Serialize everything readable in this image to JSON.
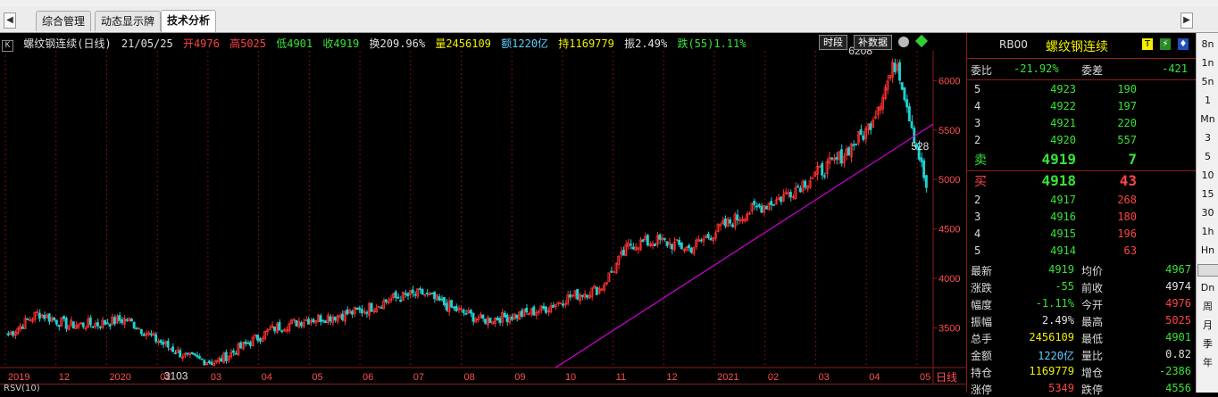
{
  "tabs": {
    "items": [
      "综合管理",
      "动态显示牌",
      "技术分析"
    ],
    "active": 2
  },
  "infobar": {
    "k_label": "K",
    "name": "螺纹钢连续(日线)",
    "date": "21/05/25",
    "open": "开4976",
    "high": "高5025",
    "low": "低4901",
    "close": "收4919",
    "turnover": "换209.96%",
    "volume": "量2456109",
    "amount": "额1220亿",
    "position": "持1169779",
    "amplitude": "振2.49%",
    "change": "跌(55)1.11%",
    "btn_period": "时段",
    "btn_fill": "补数据"
  },
  "chart_data": {
    "type": "candlestick",
    "title": "螺纹钢连续(日线)",
    "x_ticks": [
      "2019",
      "12",
      "2020",
      "02",
      "03",
      "04",
      "05",
      "06",
      "07",
      "08",
      "09",
      "10",
      "11",
      "12",
      "2021",
      "02",
      "03",
      "04",
      "05"
    ],
    "y_ticks": [
      3500,
      4000,
      4500,
      5000,
      5500,
      6000
    ],
    "ylim": [
      3100,
      6300
    ],
    "annotations": [
      {
        "text": "6208",
        "value": 6208
      },
      {
        "text": "3103",
        "value": 3103
      },
      {
        "text": "528",
        "value": 5280
      }
    ],
    "trendline_color": "#d400d4",
    "up_color": "#ff3030",
    "down_color": "#20d0d0",
    "axis_label_right": "日线",
    "monthly_close_approx": [
      3430,
      3650,
      3530,
      3540,
      3590,
      3380,
      3210,
      3150,
      3330,
      3500,
      3580,
      3620,
      3680,
      3800,
      3850,
      3700,
      3580,
      3620,
      3680,
      3820,
      3900,
      4350,
      4380,
      4300,
      4500,
      4680,
      4800,
      5000,
      5200,
      5500,
      6208,
      4919
    ],
    "last_close": 4919
  },
  "quote": {
    "code": "RB00",
    "name": "螺纹钢连续",
    "icons": [
      "T",
      "⚡",
      "♦"
    ],
    "weibi_label": "委比",
    "weibi_value": "-21.92%",
    "weicha_label": "委差",
    "weicha_value": "-421",
    "asks": [
      {
        "level": "5",
        "price": "4923",
        "vol": "190"
      },
      {
        "level": "4",
        "price": "4922",
        "vol": "197"
      },
      {
        "level": "3",
        "price": "4921",
        "vol": "220"
      },
      {
        "level": "2",
        "price": "4920",
        "vol": "557"
      },
      {
        "level": "卖",
        "price": "4919",
        "vol": "7"
      }
    ],
    "bids": [
      {
        "level": "买",
        "price": "4918",
        "vol": "43"
      },
      {
        "level": "2",
        "price": "4917",
        "vol": "268"
      },
      {
        "level": "3",
        "price": "4916",
        "vol": "180"
      },
      {
        "level": "4",
        "price": "4915",
        "vol": "196"
      },
      {
        "level": "5",
        "price": "4914",
        "vol": "63"
      }
    ],
    "stats": [
      {
        "l1": "最新",
        "v1": "4919",
        "c1": "#38e338",
        "l2": "均价",
        "v2": "4967",
        "c2": "#38e338"
      },
      {
        "l1": "涨跌",
        "v1": "-55",
        "c1": "#38e338",
        "l2": "前收",
        "v2": "4974",
        "c2": "#e0e0e0"
      },
      {
        "l1": "幅度",
        "v1": "-1.11%",
        "c1": "#38e338",
        "l2": "今开",
        "v2": "4976",
        "c2": "#ff4444"
      },
      {
        "l1": "振幅",
        "v1": "2.49%",
        "c1": "#e0e0e0",
        "l2": "最高",
        "v2": "5025",
        "c2": "#ff4444"
      },
      {
        "l1": "总手",
        "v1": "2456109",
        "c1": "#f0f000",
        "l2": "最低",
        "v2": "4901",
        "c2": "#38e338"
      },
      {
        "l1": "金额",
        "v1": "1220亿",
        "c1": "#5fd0ff",
        "l2": "量比",
        "v2": "0.82",
        "c2": "#e0e0e0"
      },
      {
        "l1": "持仓",
        "v1": "1169779",
        "c1": "#f0f000",
        "l2": "增仓",
        "v2": "-2386",
        "c2": "#38e338"
      },
      {
        "l1": "涨停",
        "v1": "5349",
        "c1": "#ff4444",
        "l2": "跌停",
        "v2": "4556",
        "c2": "#38e338"
      }
    ]
  },
  "sidebar": {
    "items": [
      "8n",
      "1n",
      "5n",
      "1",
      "Mn",
      "3",
      "5",
      "10",
      "15",
      "30",
      "1h",
      "Hn",
      "",
      "Dn",
      "周",
      "月",
      "季",
      "年"
    ]
  },
  "bottom_label": "RSV(10)"
}
